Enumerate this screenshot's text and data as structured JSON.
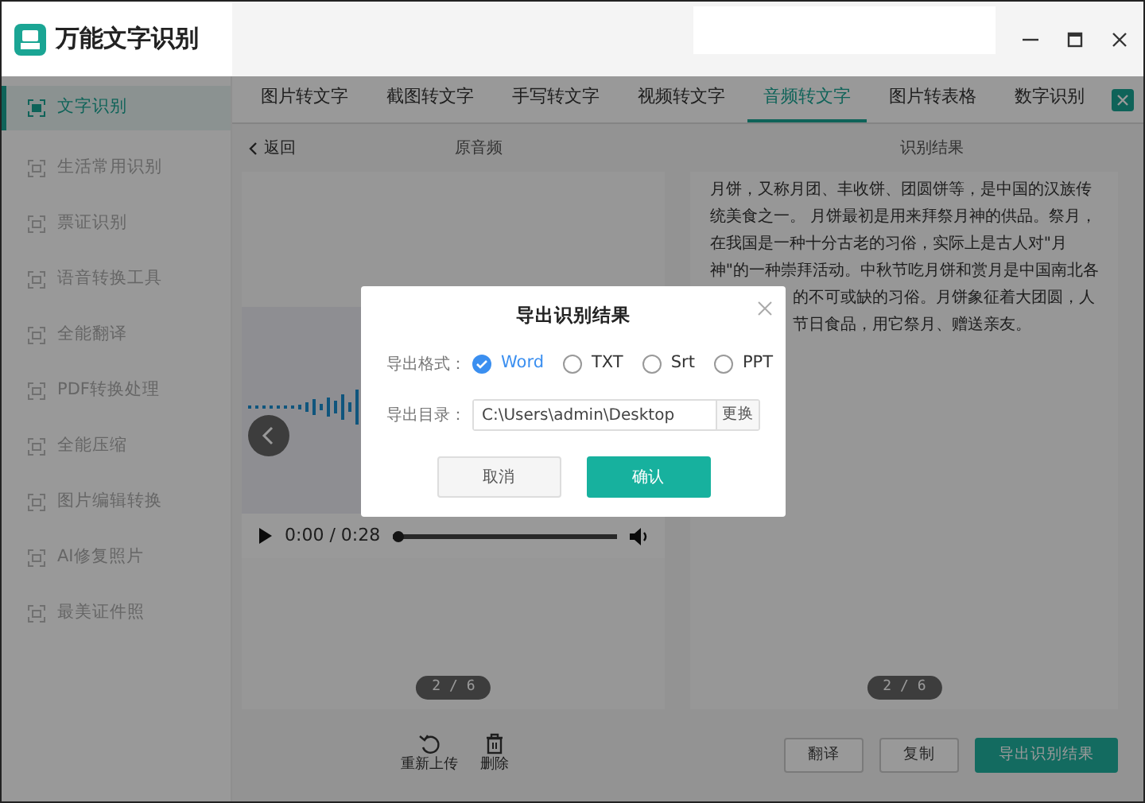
{
  "app": {
    "title": "万能文字识别"
  },
  "sidebar": {
    "items": [
      {
        "label": "文字识别",
        "selected": true
      },
      {
        "label": "生活常用识别",
        "selected": false
      },
      {
        "label": "票证识别",
        "selected": false
      },
      {
        "label": "语音转换工具",
        "selected": false
      },
      {
        "label": "全能翻译",
        "selected": false
      },
      {
        "label": "PDF转换处理",
        "selected": false
      },
      {
        "label": "全能压缩",
        "selected": false
      },
      {
        "label": "图片编辑转换",
        "selected": false
      },
      {
        "label": "AI修复照片",
        "selected": false
      },
      {
        "label": "最美证件照",
        "selected": false
      }
    ]
  },
  "tabs": [
    {
      "label": "图片转文字",
      "selected": false
    },
    {
      "label": "截图转文字",
      "selected": false
    },
    {
      "label": "手写转文字",
      "selected": false
    },
    {
      "label": "视频转文字",
      "selected": false
    },
    {
      "label": "音频转文字",
      "selected": true
    },
    {
      "label": "图片转表格",
      "selected": false
    },
    {
      "label": "数字识别",
      "selected": false
    }
  ],
  "subheader": {
    "back": "返回",
    "left_title": "原音频",
    "right_title": "识别结果"
  },
  "audio": {
    "time": "0:00 / 0:28",
    "level": 0,
    "page": "2 / 6"
  },
  "result": {
    "lines": [
      {
        "kind": "full",
        "text": "月饼，又称月团、丰收饼、团圆饼等，是中国的汉族传"
      },
      {
        "kind": "full",
        "text": "统美食之一。 月饼最初是用来拜祭月神的供品。祭月，"
      },
      {
        "kind": "full",
        "text": "在我国是一种十分古老的习俗，实际上是古人对\"月"
      },
      {
        "kind": "full",
        "text": "神\"的一种崇拜活动。中秋节吃月饼和赏月是中国南北各"
      },
      {
        "kind": "partial",
        "text": "的不可或缺的习俗。月饼象征着大团圆，人"
      },
      {
        "kind": "partial",
        "text": "节日食品，用它祭月、赠送亲友。"
      }
    ],
    "page": "2 / 6"
  },
  "bottom_left": [
    {
      "kind": "reupload",
      "label": "重新上传"
    },
    {
      "kind": "delete",
      "label": "删除"
    }
  ],
  "bottom_right": [
    {
      "label": "翻译",
      "primary": false
    },
    {
      "label": "复制",
      "primary": false
    },
    {
      "label": "导出识别结果",
      "primary": true
    }
  ],
  "dialog": {
    "title": "导出识别结果",
    "format_label": "导出格式：",
    "formats": [
      {
        "label": "Word",
        "selected": true
      },
      {
        "label": "TXT",
        "selected": false
      },
      {
        "label": "Srt",
        "selected": false
      },
      {
        "label": "PPT",
        "selected": false
      }
    ],
    "dir_label": "导出目录：",
    "dir_value": "C:\\Users\\admin\\Desktop",
    "change": "更换",
    "cancel": "取消",
    "confirm": "确认"
  }
}
